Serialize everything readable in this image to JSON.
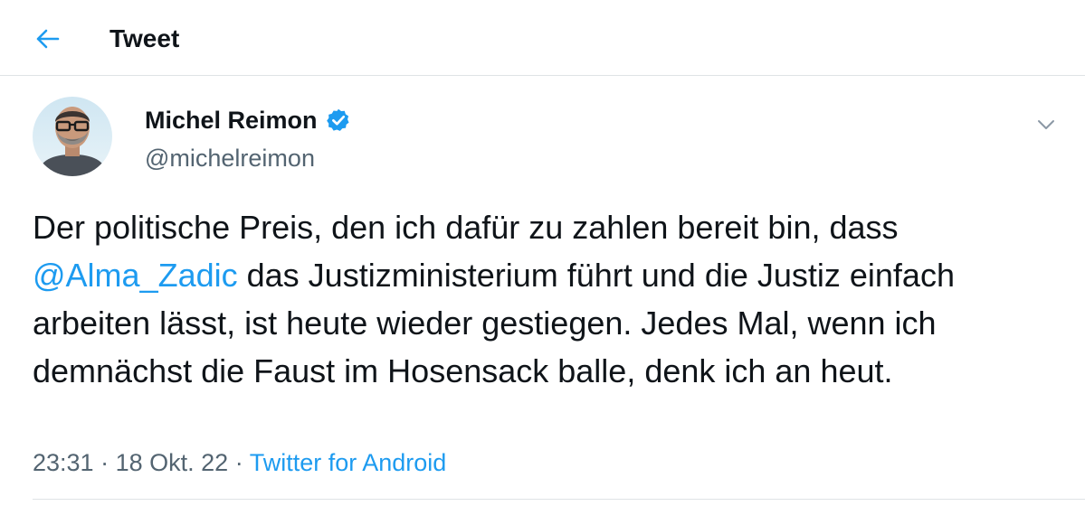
{
  "header": {
    "back_icon": "arrow-left-icon",
    "title": "Tweet"
  },
  "tweet": {
    "author": {
      "name": "Michel Reimon",
      "handle": "@michelreimon",
      "verified": true,
      "verified_icon": "verified-badge-icon"
    },
    "more_icon": "chevron-down-icon",
    "text_before_mention": "Der politische Preis, den ich dafür zu zahlen bereit bin, dass ",
    "mention": "@Alma_Zadic",
    "text_after_mention": " das Justizministerium führt und die Justiz einfach arbeiten lässt, ist heute wieder gestiegen. Jedes Mal, wenn ich demnächst die Faust im Hosensack balle, denk ich an heut.",
    "time": "23:31",
    "date": "18 Okt. 22",
    "separator": "·",
    "source": "Twitter for Android"
  },
  "colors": {
    "accent": "#1d9bf0",
    "secondary_text": "#536471",
    "primary_text": "#0f1419",
    "divider": "#dfe3e6"
  }
}
